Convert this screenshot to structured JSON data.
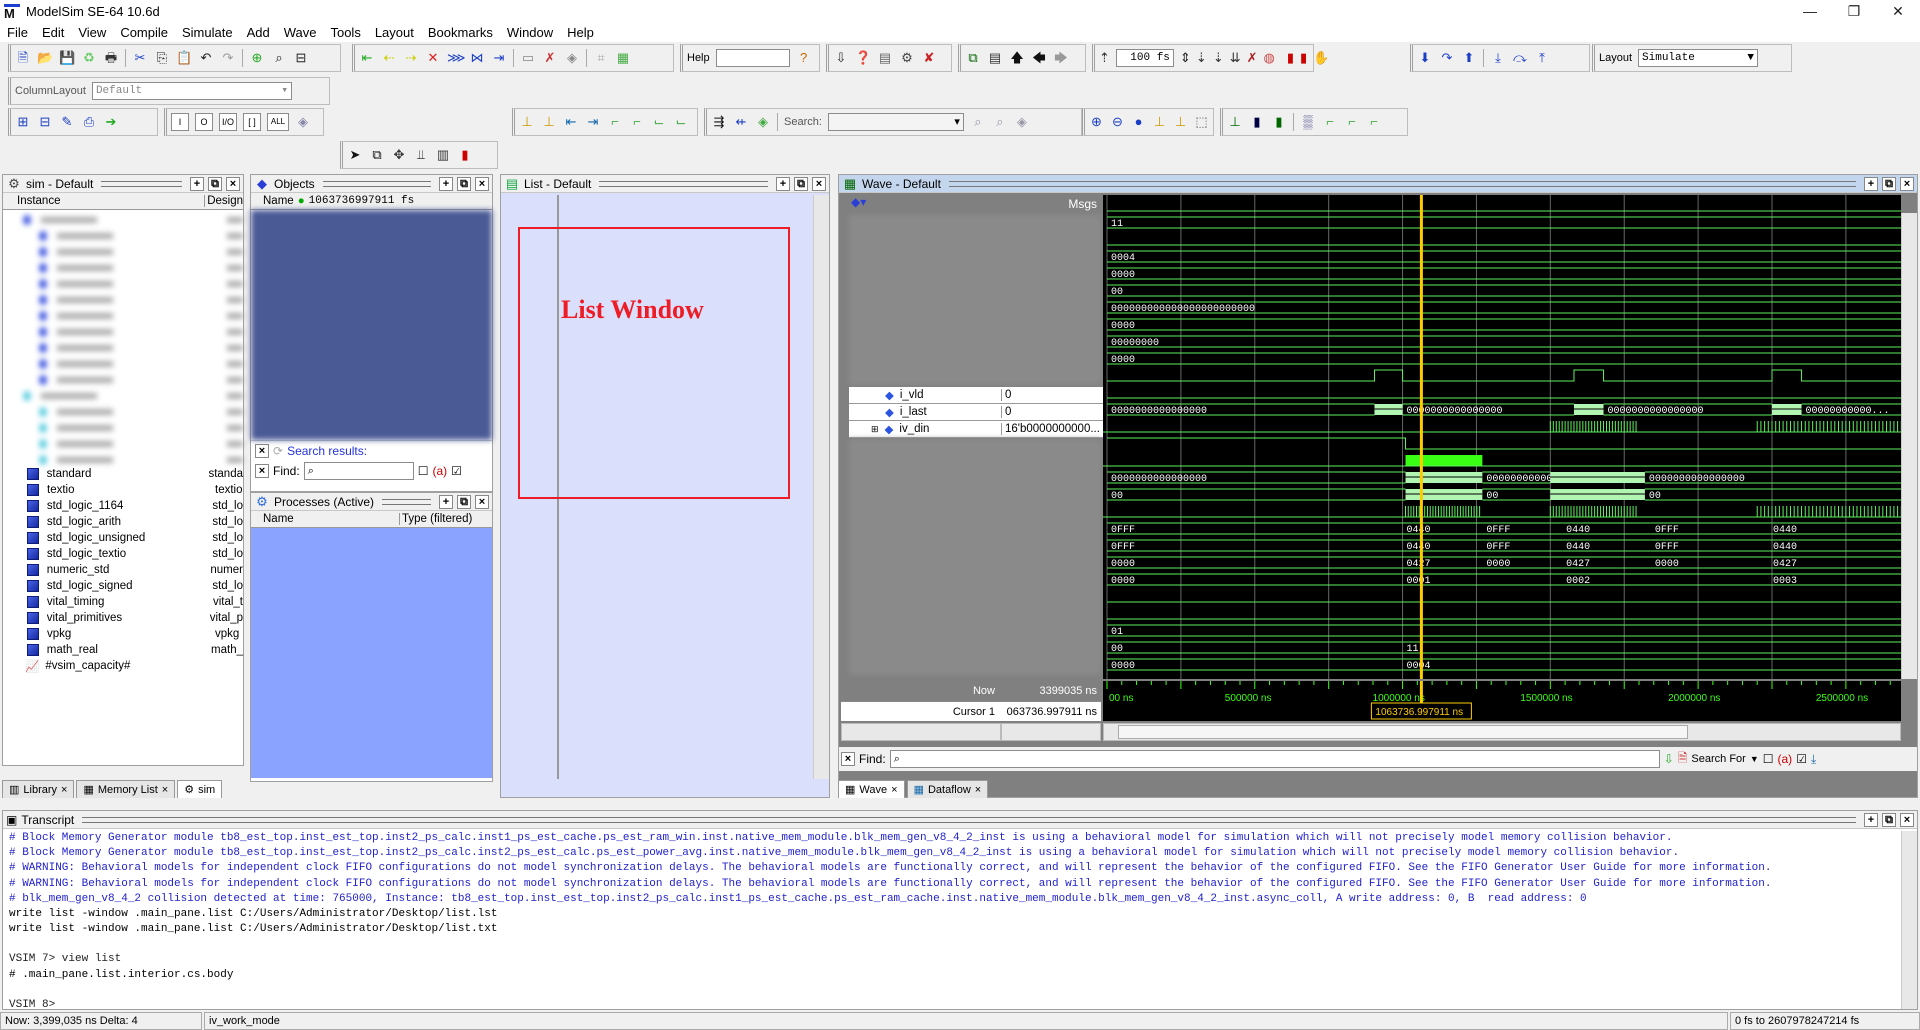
{
  "app": {
    "title": "ModelSim SE-64 10.6d",
    "logo": "M"
  },
  "window_controls": {
    "minimize": "—",
    "maximize": "❐",
    "close": "✕"
  },
  "menu": [
    "File",
    "Edit",
    "View",
    "Compile",
    "Simulate",
    "Add",
    "Wave",
    "Tools",
    "Layout",
    "Bookmarks",
    "Window",
    "Help"
  ],
  "toolbar": {
    "help_label": "Help",
    "help_value": "",
    "run_length": "100 fs",
    "layout_label": "Layout",
    "layout_value": "Simulate",
    "column_layout_label": "ColumnLayout",
    "column_layout_value": "Default",
    "search_label": "Search:",
    "search_value": "",
    "filter_buttons": [
      "I",
      "O",
      "I/O",
      "[ ]",
      "ALL"
    ]
  },
  "sim_panel": {
    "title": "sim - Default",
    "columns": [
      "Instance",
      "Design"
    ],
    "blurred_rows": 16,
    "libraries": [
      {
        "name": "standard",
        "design": "standa"
      },
      {
        "name": "textio",
        "design": "textio"
      },
      {
        "name": "std_logic_1164",
        "design": "std_lo"
      },
      {
        "name": "std_logic_arith",
        "design": "std_lo"
      },
      {
        "name": "std_logic_unsigned",
        "design": "std_lo"
      },
      {
        "name": "std_logic_textio",
        "design": "std_lo"
      },
      {
        "name": "numeric_std",
        "design": "numer"
      },
      {
        "name": "std_logic_signed",
        "design": "std_lo"
      },
      {
        "name": "vital_timing",
        "design": "vital_t"
      },
      {
        "name": "vital_primitives",
        "design": "vital_p"
      },
      {
        "name": "vpkg",
        "design": "vpkg"
      },
      {
        "name": "math_real",
        "design": "math_"
      }
    ],
    "capacity_item": "#vsim_capacity#",
    "tabs": [
      "Library",
      "Memory List",
      "sim"
    ]
  },
  "objects_panel": {
    "title": "Objects",
    "name_col": "Name",
    "time": "1063736997911 fs",
    "search_results_label": "Search results:",
    "find_label": "Find:",
    "find_value": ""
  },
  "processes_panel": {
    "title": "Processes (Active)",
    "columns": [
      "Name",
      "Type (filtered)"
    ]
  },
  "list_panel": {
    "title": "List - Default",
    "annotation": "List Window"
  },
  "wave_panel": {
    "title": "Wave - Default",
    "msgs_label": "Msgs",
    "signals": [
      {
        "name": "i_vld",
        "value": "0"
      },
      {
        "name": "i_last",
        "value": "0"
      },
      {
        "name": "iv_din",
        "value": "16'b0000000000..."
      }
    ],
    "now_label": "Now",
    "now_value": "3399035 ns",
    "cursor_label": "Cursor 1",
    "cursor_value": "063736.997911 ns",
    "cursor_marker": "1063736.997911 ns",
    "time_ticks": [
      "00 ns",
      "500000 ns",
      "1000000 ns",
      "1500000 ns",
      "2000000 ns",
      "2500000 ns"
    ],
    "find_label": "Find:",
    "search_for_label": "Search For",
    "tabs": [
      "Wave",
      "Dataflow"
    ],
    "trace_labels": {
      "r1": "11",
      "r3": "0004",
      "r4": "0000",
      "r5": "00",
      "r6": "000000000000000000000000",
      "r7": "0000",
      "r8": "00000000",
      "r9": "0000",
      "iv_din_a": "0000000000000000",
      "iv_din_b": "0000000000000000",
      "iv_din_c": "0000000000000000",
      "iv_din_d": "00000000000...",
      "bus1_a": "0000000000000000",
      "bus1_b": "0000000000000000",
      "bus1_c": "0000000000000000",
      "bus2_a": "00",
      "bus2_b": "00",
      "bus2_c": "00",
      "h1": [
        "0FFF",
        "0440",
        "0FFF",
        "0440",
        "0FFF",
        "0440"
      ],
      "h2": [
        "0FFF",
        "0440",
        "0FFF",
        "0440",
        "0FFF",
        "0440"
      ],
      "h3": [
        "0000",
        "0427",
        "0000",
        "0427",
        "0000",
        "0427"
      ],
      "h4": [
        "0000",
        "0001",
        "0002",
        "0003"
      ],
      "r18": "01",
      "r19a": "00",
      "r19b": "11",
      "r20a": "0000",
      "r20b": "0004"
    }
  },
  "transcript": {
    "title": "Transcript",
    "lines": [
      {
        "text": "# Block Memory Generator module tb8_est_top.inst_est_top.inst2_ps_calc.inst1_ps_est_cache.ps_est_ram_win.inst.native_mem_module.blk_mem_gen_v8_4_2_inst is using a behavioral model for simulation which will not precisely model memory collision behavior.",
        "blue": true
      },
      {
        "text": "# Block Memory Generator module tb8_est_top.inst_est_top.inst2_ps_calc.inst2_ps_est_calc.ps_est_power_avg.inst.native_mem_module.blk_mem_gen_v8_4_2_inst is using a behavioral model for simulation which will not precisely model memory collision behavior.",
        "blue": true
      },
      {
        "text": "# WARNING: Behavioral models for independent clock FIFO configurations do not model synchronization delays. The behavioral models are functionally correct, and will represent the behavior of the configured FIFO. See the FIFO Generator User Guide for more information.",
        "blue": true
      },
      {
        "text": "# WARNING: Behavioral models for independent clock FIFO configurations do not model synchronization delays. The behavioral models are functionally correct, and will represent the behavior of the configured FIFO. See the FIFO Generator User Guide for more information.",
        "blue": true
      },
      {
        "text": "# blk_mem_gen_v8_4_2 collision detected at time: 765000, Instance: tb8_est_top.inst_est_top.inst2_ps_calc.inst1_ps_est_cache.ps_est_ram_cache.inst.native_mem_module.blk_mem_gen_v8_4_2_inst.async_coll, A write address: 0, B  read address: 0",
        "blue": true
      },
      {
        "text": "write list -window .main_pane.list C:/Users/Administrator/Desktop/list.lst",
        "blue": false
      },
      {
        "text": "write list -window .main_pane.list C:/Users/Administrator/Desktop/list.txt",
        "blue": false
      },
      {
        "text": "",
        "blue": false
      },
      {
        "text": "VSIM 7> view list",
        "blue": false,
        "prompt": true
      },
      {
        "text": "# .main_pane.list.interior.cs.body",
        "blue": false
      },
      {
        "text": "",
        "blue": false
      },
      {
        "text": "VSIM 8>",
        "blue": false,
        "prompt": true
      }
    ]
  },
  "status_bar": {
    "now": "Now: 3,399,035 ns  Delta: 4",
    "context": "iv_work_mode",
    "range": "0 fs to 2607978247214 fs"
  },
  "colors": {
    "wave_bg": "#000000",
    "trace": "#5ef25e",
    "bus_fill": "#b2f5b2",
    "cursor": "#ffcc00",
    "list_bg": "#dae0fb",
    "annotation": "#ee1c24",
    "processes_bg": "#8aa3ff",
    "objects_bg": "#4a5a95"
  }
}
